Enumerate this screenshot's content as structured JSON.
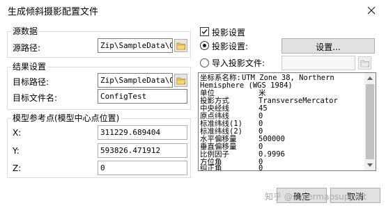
{
  "window": {
    "title": "生成倾斜摄影配置文件"
  },
  "source": {
    "group_title": "源数据",
    "path_label": "源路径:",
    "path_value": "Zip\\SampleData\\OSGB"
  },
  "result": {
    "group_title": "结果设置",
    "target_path_label": "目标路径:",
    "target_path_value": "Zip\\SampleData\\OSGB",
    "target_file_label": "目标文件名:",
    "target_file_value": "ConfigTest"
  },
  "model_ref": {
    "group_title": "模型参考点(模型中心点位置)",
    "x_label": "X:",
    "x_value": "311229.689404",
    "y_label": "Y:",
    "y_value": "593826.471912",
    "z_label": "Z:",
    "z_value": "0"
  },
  "projection": {
    "checkbox_label": "投影设置",
    "checked": true,
    "radio_settings_label": "投影设置:",
    "settings_button_label": "设置...",
    "radio_import_label": "导入投影文件:",
    "import_value": "",
    "selected": "settings"
  },
  "projection_info": {
    "line1_key": "坐标系名称:",
    "line1_val": "UTM Zone 38, Northern",
    "line2": "Hemisphere (WGS 1984)",
    "rows": [
      {
        "key": "单位",
        "value": "米"
      },
      {
        "key": "投影方式",
        "value": "TransverseMercator"
      },
      {
        "key": "中央经线",
        "value": "45"
      },
      {
        "key": "原点纬线",
        "value": "0"
      },
      {
        "key": "标准纬线(1)",
        "value": "0"
      },
      {
        "key": "标准纬线(2)",
        "value": "0"
      },
      {
        "key": "水平偏移量",
        "value": "500000"
      },
      {
        "key": "垂直偏移量",
        "value": "0"
      },
      {
        "key": "比例因子",
        "value": "0.9996"
      },
      {
        "key": "方位角",
        "value": "0"
      },
      {
        "key": "纠正角",
        "value": "0"
      }
    ]
  },
  "footer": {
    "ok_label": "确定",
    "cancel_label": "取消",
    "watermark": "知乎 @supermapsupport"
  }
}
